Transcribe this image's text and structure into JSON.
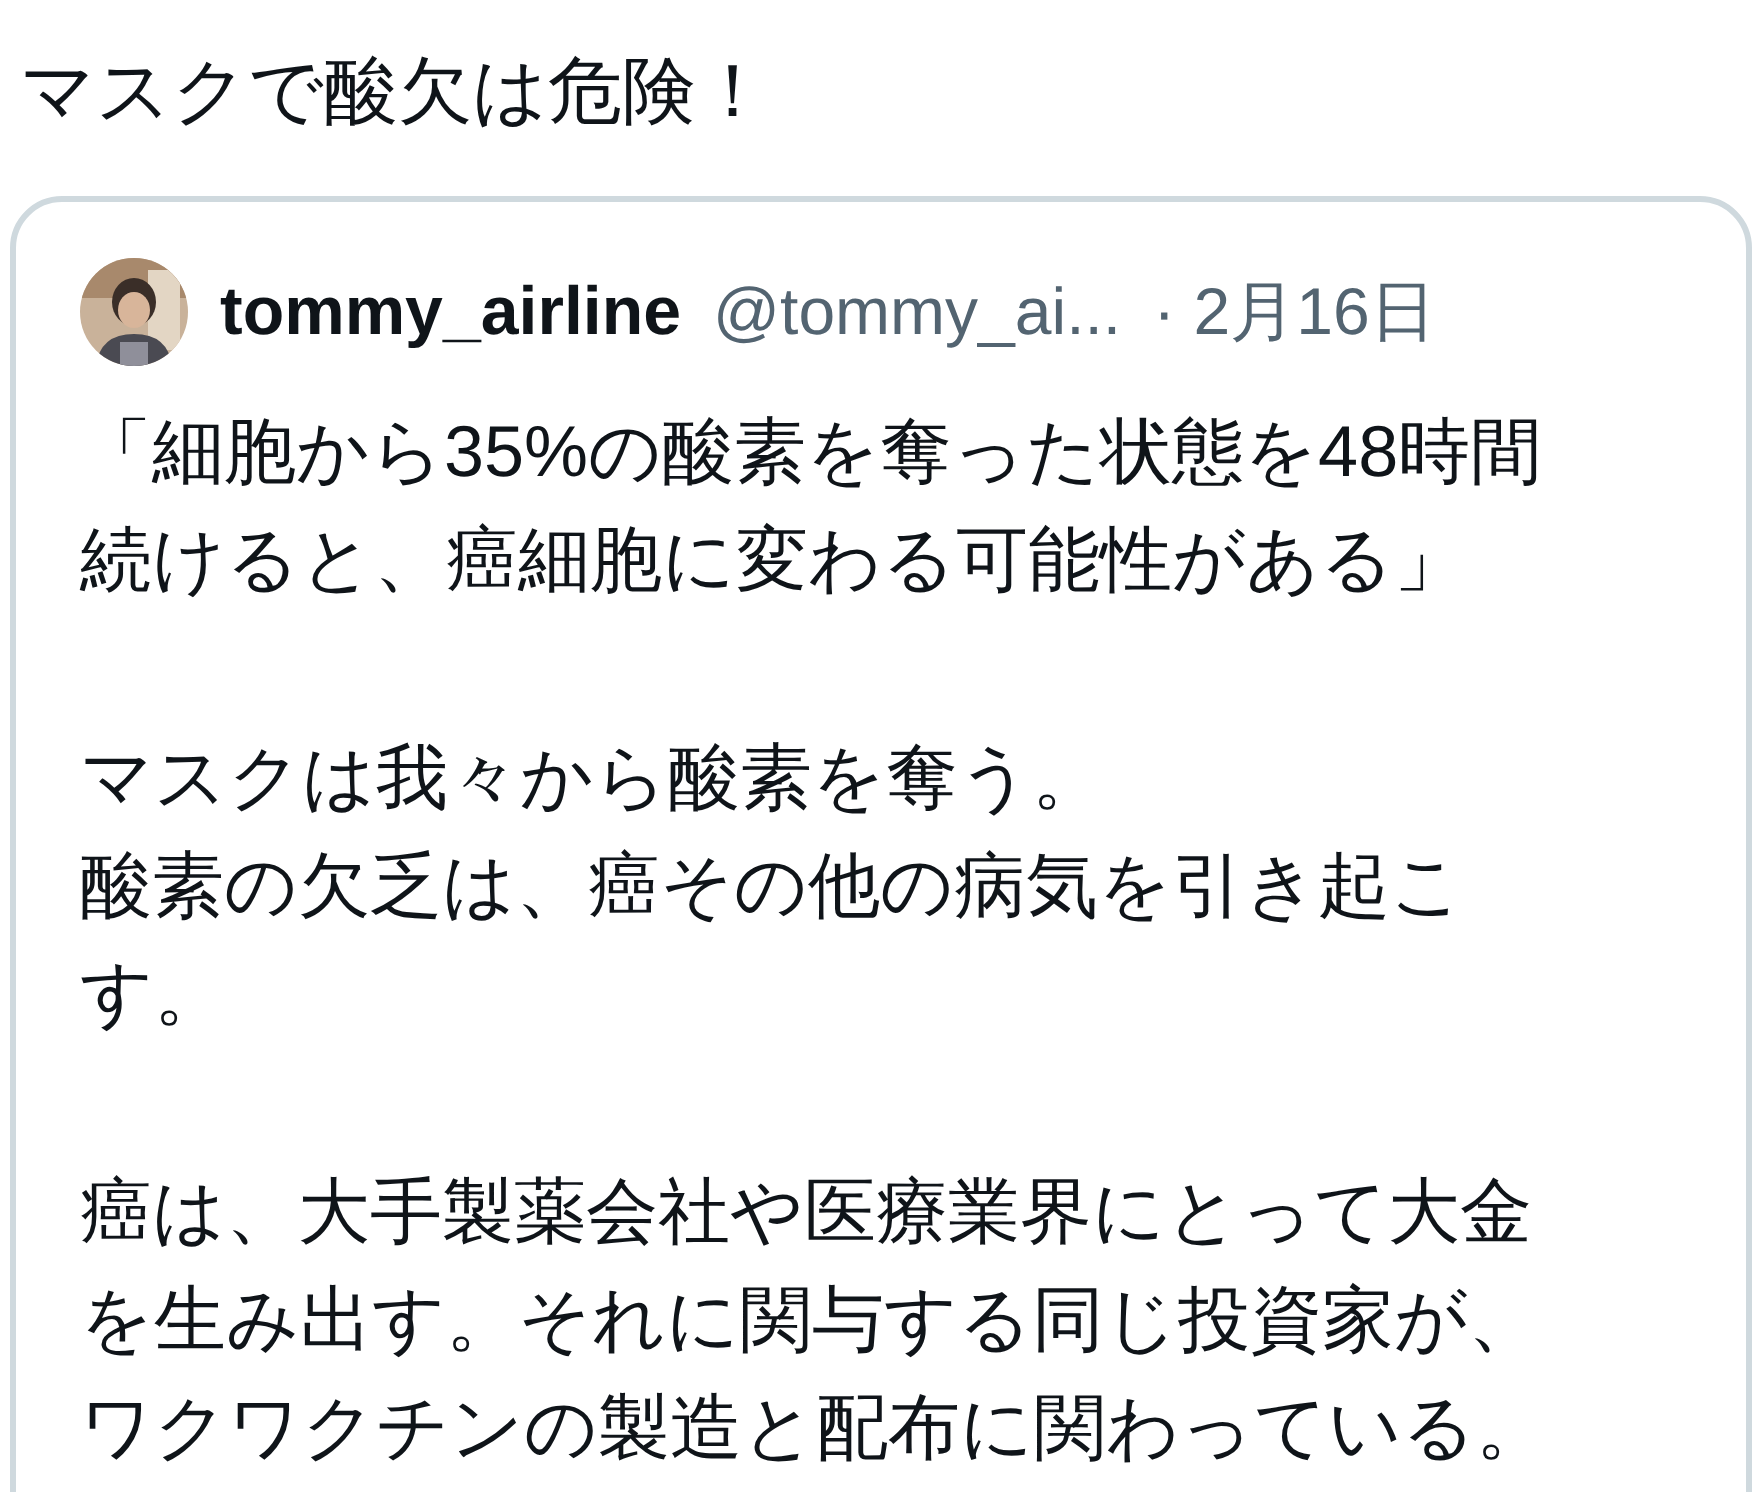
{
  "tweet_text": "マスクで酸欠は危険！",
  "quoted_tweet": {
    "author_name": "tommy_airline",
    "handle": "@tommy_ai...",
    "date": "· 2月16日",
    "paragraphs": [
      {
        "lines": [
          "「細胞から35%の酸素を奪った状態を48時間",
          "続けると、癌細胞に変わる可能性がある」"
        ]
      },
      {
        "lines": [
          "マスクは我々から酸素を奪う。",
          "酸素の欠乏は、癌その他の病気を引き起こ",
          "す。"
        ]
      },
      {
        "lines": [
          "癌は、大手製薬会社や医療業界にとって大金",
          "を生み出す。それに関与する同じ投資家が、",
          "ワクワクチンの製造と配布に関わっている。"
        ]
      }
    ]
  }
}
